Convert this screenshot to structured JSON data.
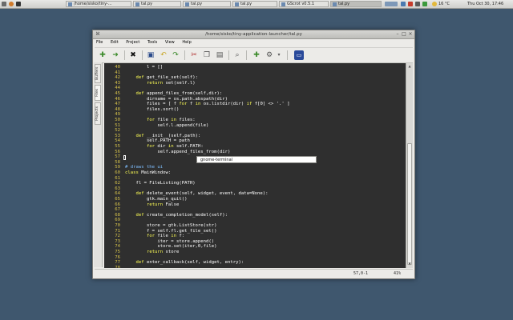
{
  "panel": {
    "tasks": [
      "/home/sisko/tiny-...",
      "tal.py",
      "tal.py",
      "tal.py",
      "GScrot v0.5.1",
      "tal.py"
    ],
    "weather": "16 °C",
    "clock": "Thu Oct 30, 17:46"
  },
  "window": {
    "title": "/home/sisko/tiny-application-launcher/tal.py",
    "menu": [
      "File",
      "Edit",
      "Project",
      "Tools",
      "View",
      "Help"
    ],
    "side_tabs": [
      "Buffers",
      "Files",
      "Projects"
    ]
  },
  "editor": {
    "lines": [
      {
        "n": "40",
        "t": "        l = []"
      },
      {
        "n": "41",
        "t": ""
      },
      {
        "n": "42",
        "t": "    def get_file_set(self):"
      },
      {
        "n": "43",
        "t": "        return set(self.l)"
      },
      {
        "n": "44",
        "t": ""
      },
      {
        "n": "45",
        "t": "    def append_files_from(self,dir):"
      },
      {
        "n": "46",
        "t": "        dirname = os.path.abspath(dir)"
      },
      {
        "n": "47",
        "t": "        files = [ f for f in os.listdir(dir) if f[0] <> '.' ]"
      },
      {
        "n": "48",
        "t": "        files.sort()"
      },
      {
        "n": "49",
        "t": ""
      },
      {
        "n": "50",
        "t": "        for file in files:"
      },
      {
        "n": "51",
        "t": "            self.l.append(file)"
      },
      {
        "n": "52",
        "t": ""
      },
      {
        "n": "53",
        "t": "    def __init__(self,path):"
      },
      {
        "n": "54",
        "t": "        self.PATH = path"
      },
      {
        "n": "55",
        "t": "        for dir in self.PATH:"
      },
      {
        "n": "56",
        "t": "            self.append_files_from(dir)"
      },
      {
        "n": "57",
        "t": ""
      },
      {
        "n": "58",
        "t": ""
      },
      {
        "n": "59",
        "t": "# draws the ui"
      },
      {
        "n": "60",
        "t": "class MainWindow:"
      },
      {
        "n": "61",
        "t": ""
      },
      {
        "n": "62",
        "t": "    fl = FileListing(PATH)"
      },
      {
        "n": "63",
        "t": ""
      },
      {
        "n": "64",
        "t": "    def delete_event(self, widget, event, data=None):"
      },
      {
        "n": "65",
        "t": "        gtk.main_quit()"
      },
      {
        "n": "66",
        "t": "        return False"
      },
      {
        "n": "67",
        "t": ""
      },
      {
        "n": "68",
        "t": "    def create_completion_model(self):"
      },
      {
        "n": "69",
        "t": ""
      },
      {
        "n": "70",
        "t": "        store = gtk.ListStore(str)"
      },
      {
        "n": "71",
        "t": "        f = self.fl.get_file_set()"
      },
      {
        "n": "72",
        "t": "        for file in f:"
      },
      {
        "n": "73",
        "t": "            iter = store.append()"
      },
      {
        "n": "74",
        "t": "            store.set(iter,0,file)"
      },
      {
        "n": "75",
        "t": "        return store"
      },
      {
        "n": "76",
        "t": ""
      },
      {
        "n": "77",
        "t": "    def enter_callback(self, widget, entry):"
      },
      {
        "n": "78",
        "t": ""
      }
    ],
    "popup_text": "gnome-terminal"
  },
  "status": {
    "position": "57,0-1",
    "percent": "41%"
  }
}
